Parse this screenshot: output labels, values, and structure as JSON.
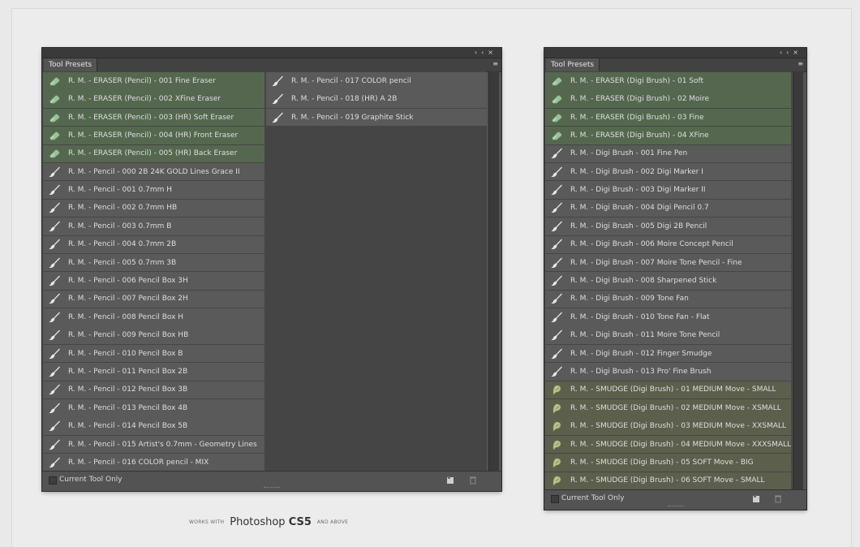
{
  "window_controls": {
    "collapse": "‹‹",
    "close": "×"
  },
  "panel_menu_icon": "≡",
  "left_panel": {
    "tab_label": "Tool Presets",
    "footer_checkbox_label": "Current Tool Only",
    "column1": [
      {
        "type": "eraser",
        "label": "R. M. - ERASER (Pencil) - 001 Fine Eraser"
      },
      {
        "type": "eraser",
        "label": "R. M. - ERASER (Pencil) - 002 XFine Eraser"
      },
      {
        "type": "eraser",
        "label": "R. M. - ERASER (Pencil) - 003 (HR) Soft Eraser"
      },
      {
        "type": "eraser",
        "label": "R. M. - ERASER (Pencil) - 004 (HR) Front Eraser"
      },
      {
        "type": "eraser",
        "label": "R. M. - ERASER (Pencil) - 005 (HR) Back Eraser"
      },
      {
        "type": "pencil",
        "label": "R. M. - Pencil - 000 2B 24K GOLD Lines Grace II"
      },
      {
        "type": "pencil",
        "label": "R. M. - Pencil - 001 0.7mm H"
      },
      {
        "type": "pencil",
        "label": "R. M. - Pencil - 002 0.7mm HB"
      },
      {
        "type": "pencil",
        "label": "R. M. - Pencil - 003 0.7mm B"
      },
      {
        "type": "pencil",
        "label": "R. M. - Pencil - 004 0.7mm 2B"
      },
      {
        "type": "pencil",
        "label": "R. M. - Pencil - 005 0.7mm 3B"
      },
      {
        "type": "pencil",
        "label": "R. M. - Pencil - 006 Pencil Box 3H"
      },
      {
        "type": "pencil",
        "label": "R. M. - Pencil - 007 Pencil Box 2H"
      },
      {
        "type": "pencil",
        "label": "R. M. - Pencil - 008 Pencil Box H"
      },
      {
        "type": "pencil",
        "label": "R. M. - Pencil - 009 Pencil Box HB"
      },
      {
        "type": "pencil",
        "label": "R. M. - Pencil - 010 Pencil Box B"
      },
      {
        "type": "pencil",
        "label": "R. M. - Pencil - 011 Pencil Box 2B"
      },
      {
        "type": "pencil",
        "label": "R. M. - Pencil - 012 Pencil Box 3B"
      },
      {
        "type": "pencil",
        "label": "R. M. - Pencil - 013 Pencil Box 4B"
      },
      {
        "type": "pencil",
        "label": "R. M. - Pencil - 014 Pencil Box 5B"
      },
      {
        "type": "pencil",
        "label": "R. M. - Pencil - 015 Artist's 0.7mm - Geometry Lines"
      },
      {
        "type": "pencil",
        "label": "R. M. - Pencil - 016 COLOR pencil - MIX"
      }
    ],
    "column2": [
      {
        "type": "pencil",
        "label": "R. M. - Pencil - 017 COLOR pencil"
      },
      {
        "type": "pencil",
        "label": "R. M. - Pencil - 018 (HR) A 2B"
      },
      {
        "type": "pencil",
        "label": "R. M. - Pencil - 019 Graphite Stick"
      }
    ]
  },
  "right_panel": {
    "tab_label": "Tool Presets",
    "footer_checkbox_label": "Current Tool Only",
    "column1": [
      {
        "type": "eraser",
        "label": "R. M. - ERASER (Digi Brush) - 01 Soft"
      },
      {
        "type": "eraser",
        "label": "R. M. - ERASER (Digi Brush) - 02 Moire"
      },
      {
        "type": "eraser",
        "label": "R. M. - ERASER (Digi Brush) - 03 Fine"
      },
      {
        "type": "eraser",
        "label": "R. M. - ERASER (Digi Brush) - 04 XFine"
      },
      {
        "type": "pencil",
        "label": "R. M. - Digi Brush - 001 Fine Pen"
      },
      {
        "type": "pencil",
        "label": "R. M. - Digi Brush - 002 Digi Marker I"
      },
      {
        "type": "pencil",
        "label": "R. M. - Digi Brush - 003 Digi Marker II"
      },
      {
        "type": "pencil",
        "label": "R. M. - Digi Brush - 004 Digi Pencil 0.7"
      },
      {
        "type": "pencil",
        "label": "R. M. - Digi Brush - 005 Digi 2B Pencil"
      },
      {
        "type": "pencil",
        "label": "R. M. - Digi Brush - 006 Moire Concept Pencil"
      },
      {
        "type": "pencil",
        "label": "R. M. - Digi Brush - 007 Moire Tone Pencil - Fine"
      },
      {
        "type": "pencil",
        "label": "R. M. - Digi Brush - 008 Sharpened Stick"
      },
      {
        "type": "pencil",
        "label": "R. M. - Digi Brush - 009 Tone Fan"
      },
      {
        "type": "pencil",
        "label": "R. M. - Digi Brush - 010 Tone Fan - Flat"
      },
      {
        "type": "pencil",
        "label": "R. M. - Digi Brush - 011 Moire Tone Pencil"
      },
      {
        "type": "pencil",
        "label": "R. M. - Digi Brush - 012 Finger Smudge"
      },
      {
        "type": "pencil",
        "label": "R. M. - Digi Brush - 013 Pro' Fine Brush"
      },
      {
        "type": "smudge",
        "label": "R. M. - SMUDGE (Digi Brush) - 01 MEDIUM Move - SMALL"
      },
      {
        "type": "smudge",
        "label": "R. M. - SMUDGE (Digi Brush) - 02 MEDIUM Move - XSMALL"
      },
      {
        "type": "smudge",
        "label": "R. M. - SMUDGE (Digi Brush) - 03 MEDIUM Move - XXSMALL"
      },
      {
        "type": "smudge",
        "label": "R. M. - SMUDGE (Digi Brush) - 04 MEDIUM Move - XXXSMALL"
      },
      {
        "type": "smudge",
        "label": "R. M. - SMUDGE (Digi Brush) - 05 SOFT Move - BIG"
      },
      {
        "type": "smudge",
        "label": "R. M. - SMUDGE (Digi Brush) - 06 SOFT Move - SMALL"
      }
    ]
  },
  "caption": {
    "prefix": "WORKS WITH",
    "product": "Photoshop",
    "version": "CS5",
    "suffix": "AND ABOVE"
  },
  "colors": {
    "eraser_row": "#55684f",
    "pencil_row": "#5a5a5a",
    "smudge_row": "#5d5f4d",
    "panel_bg": "#535353"
  }
}
